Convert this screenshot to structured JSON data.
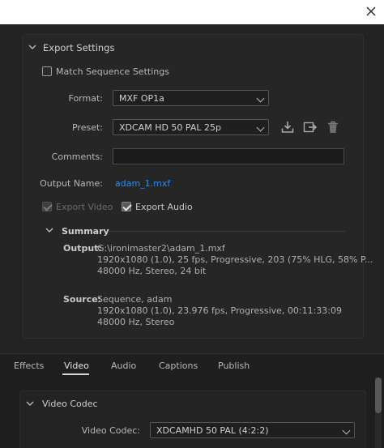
{
  "window": {
    "close_icon": "close-icon"
  },
  "export_settings": {
    "title": "Export Settings",
    "match_sequence_label": "Match Sequence Settings",
    "match_sequence_checked": false,
    "format_label": "Format:",
    "format_value": "MXF OP1a",
    "preset_label": "Preset:",
    "preset_value": "XDCAM HD 50 PAL 25p",
    "preset_icons": [
      "save-preset-icon",
      "import-preset-icon",
      "delete-preset-icon"
    ],
    "comments_label": "Comments:",
    "comments_value": "",
    "output_name_label": "Output Name:",
    "output_name_value": "adam_1.mxf",
    "export_video_label": "Export Video",
    "export_video_checked": true,
    "export_video_disabled": true,
    "export_audio_label": "Export Audio",
    "export_audio_checked": true
  },
  "summary": {
    "title": "Summary",
    "output_key": "Output:",
    "output_lines": [
      "G:\\ironimaster2\\adam_1.mxf",
      "1920x1080 (1.0), 25 fps, Progressive, 203 (75% HLG, 58% P...",
      "48000 Hz, Stereo, 24 bit"
    ],
    "source_key": "Source:",
    "source_lines": [
      "Sequence, adam",
      "1920x1080 (1.0), 23.976 fps, Progressive, 00:11:33:09",
      "48000 Hz, Stereo"
    ]
  },
  "tabs": [
    {
      "label": "Effects"
    },
    {
      "label": "Video"
    },
    {
      "label": "Audio"
    },
    {
      "label": "Captions"
    },
    {
      "label": "Publish"
    }
  ],
  "active_tab": "Video",
  "video_codec": {
    "title": "Video Codec",
    "codec_label": "Video Codec:",
    "codec_value": "XDCAMHD 50 PAL (4:2:2)"
  },
  "colors": {
    "link": "#2d8ceb",
    "background": "#232323",
    "titlebar": "#ffffff"
  }
}
